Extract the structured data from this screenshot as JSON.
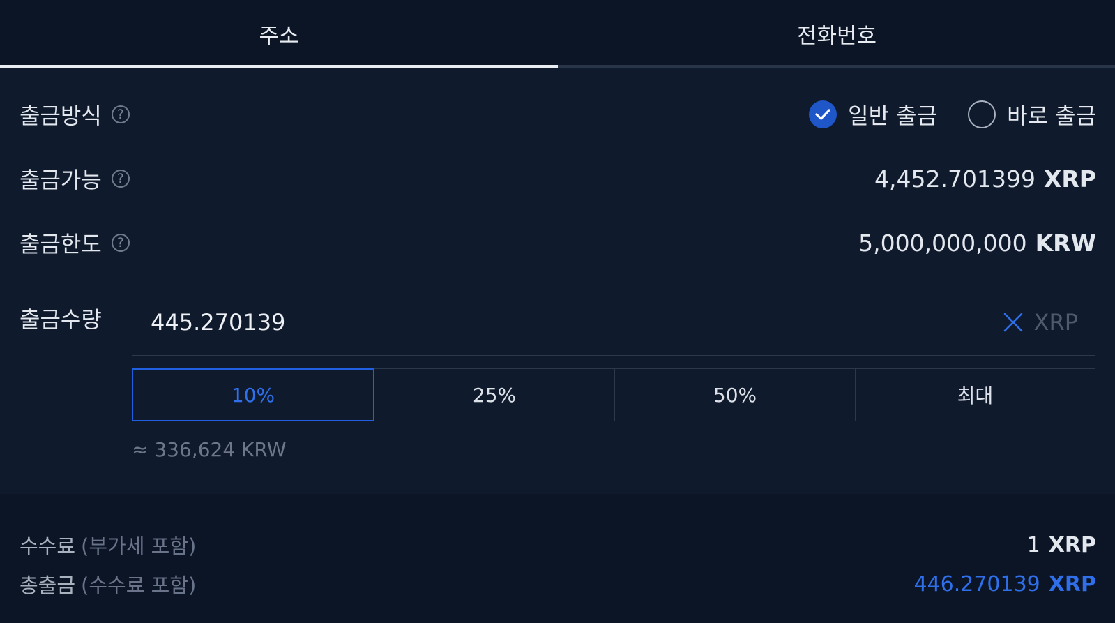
{
  "tabs": [
    {
      "label": "주소",
      "active": true
    },
    {
      "label": "전화번호",
      "active": false
    }
  ],
  "method": {
    "label": "출금방식",
    "help_icon": "?",
    "options": [
      {
        "label": "일반 출금",
        "selected": true
      },
      {
        "label": "바로 출금",
        "selected": false
      }
    ]
  },
  "available": {
    "label": "출금가능",
    "help_icon": "?",
    "value": "4,452.701399",
    "unit": "XRP"
  },
  "limit": {
    "label": "출금한도",
    "help_icon": "?",
    "value": "5,000,000,000",
    "unit": "KRW"
  },
  "amount": {
    "label": "출금수량",
    "value": "445.270139",
    "unit": "XRP",
    "krw_equivalent": "≈ 336,624 KRW",
    "percent_buttons": [
      {
        "label": "10%",
        "active": true
      },
      {
        "label": "25%",
        "active": false
      },
      {
        "label": "50%",
        "active": false
      },
      {
        "label": "최대",
        "active": false
      }
    ]
  },
  "fee": {
    "label": "수수료",
    "note": "(부가세 포함)",
    "value": "1",
    "unit": "XRP"
  },
  "total": {
    "label": "총출금",
    "note": "(수수료 포함)",
    "value": "446.270139",
    "unit": "XRP"
  },
  "colors": {
    "accent": "#1f5fe0",
    "background": "#0f1a2c",
    "footer_background": "#0b1526"
  }
}
